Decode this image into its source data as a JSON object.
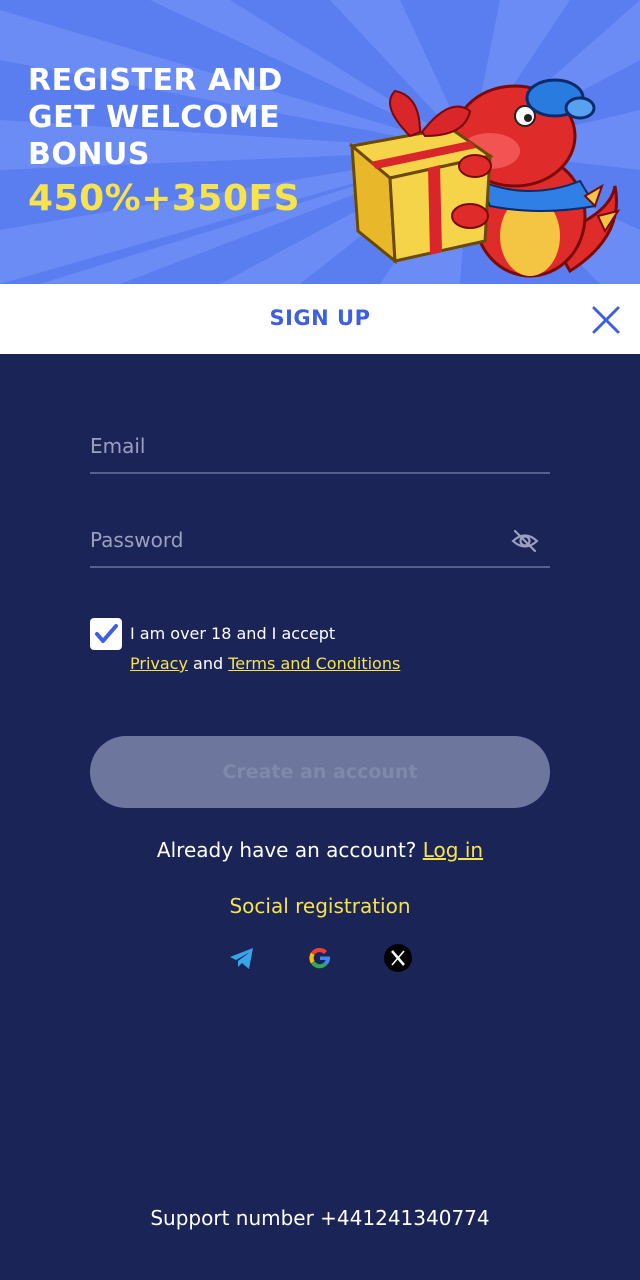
{
  "banner": {
    "title": "REGISTER AND GET WELCOME BONUS",
    "bonus": "450%+350FS"
  },
  "header": {
    "title": "SIGN UP"
  },
  "form": {
    "email_placeholder": "Email",
    "email_value": "",
    "password_placeholder": "Password",
    "password_value": "",
    "consent_checked": true,
    "consent_text": "I am over 18 and I accept",
    "privacy_link": "Privacy",
    "and_text": "and",
    "terms_link": "Terms and Conditions",
    "create_button": "Create an account"
  },
  "login": {
    "prompt": "Already have an account?",
    "link": "Log in"
  },
  "social": {
    "title": "Social registration",
    "icons": [
      "telegram-icon",
      "google-icon",
      "x-icon"
    ]
  },
  "support": {
    "text": "Support number +441241340774"
  },
  "colors": {
    "banner_bg": "#5a7ef0",
    "page_bg": "#1a2456",
    "accent_yellow": "#f7e34b",
    "header_blue": "#3d5fe0"
  }
}
